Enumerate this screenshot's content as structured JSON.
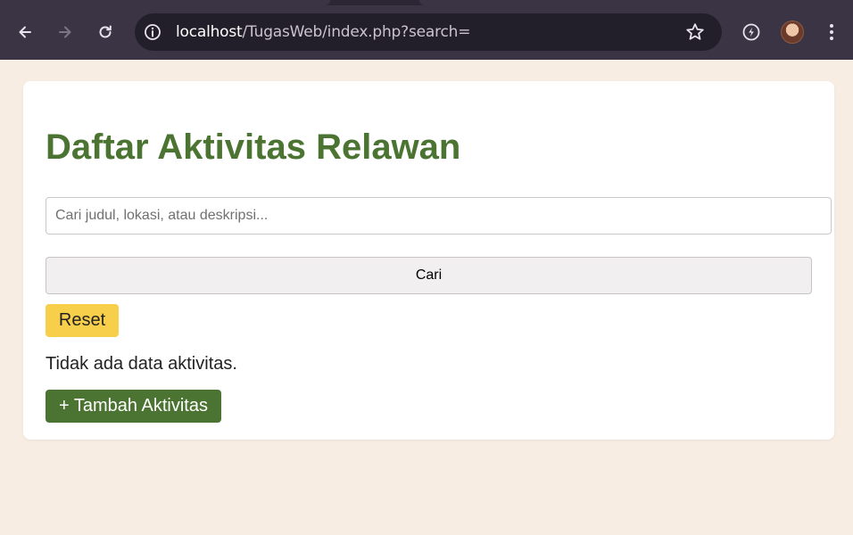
{
  "browser": {
    "url_host": "localhost",
    "url_path": "/TugasWeb/index.php?search=",
    "icons": {
      "back": "arrow-left",
      "forward": "arrow-right",
      "reload": "reload",
      "site_info": "info",
      "bookmark": "star",
      "extension": "lightning",
      "menu": "kebab"
    }
  },
  "page": {
    "title": "Daftar Aktivitas Relawan",
    "search": {
      "value": "",
      "placeholder": "Cari judul, lokasi, atau deskripsi..."
    },
    "search_button_label": "Cari",
    "reset_button_label": "Reset",
    "empty_message": "Tidak ada data aktivitas.",
    "add_button_label": "+ Tambah Aktivitas"
  },
  "colors": {
    "title_green": "#4b7432",
    "reset_yellow": "#f8cf4a",
    "add_green": "#4b7432",
    "page_background": "#f7ede3",
    "chrome_background": "#3b3445"
  }
}
